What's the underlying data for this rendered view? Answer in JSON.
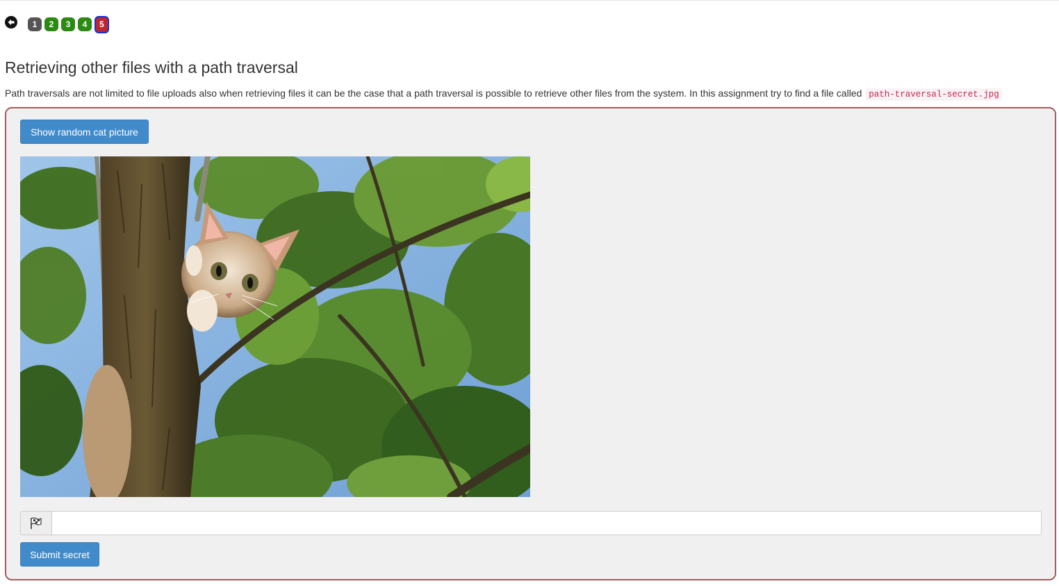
{
  "nav": {
    "back_icon": "arrow-left-circle-icon",
    "pages": [
      {
        "label": "1",
        "status": "grey",
        "color": "#555555"
      },
      {
        "label": "2",
        "status": "solved",
        "color": "#2b8a12"
      },
      {
        "label": "3",
        "status": "solved",
        "color": "#2b8a12"
      },
      {
        "label": "4",
        "status": "solved",
        "color": "#2b8a12"
      },
      {
        "label": "5",
        "status": "current",
        "color": "#c0272d"
      }
    ]
  },
  "lesson": {
    "title": "Retrieving other files with a path traversal",
    "description": "Path traversals are not limited to file uploads also when retrieving files it can be the case that a path traversal is possible to retrieve other files from the system. In this assignment try to find a file called",
    "filename": "path-traversal-secret.jpg"
  },
  "assignment": {
    "show_button_label": "Show random cat picture",
    "image_subject": "kitten climbing tree photo",
    "flag_icon": "flag-icon",
    "secret_input_value": "",
    "submit_button_label": "Submit secret",
    "panel_border_color": "#a45c5c",
    "button_color": "#428bca"
  }
}
